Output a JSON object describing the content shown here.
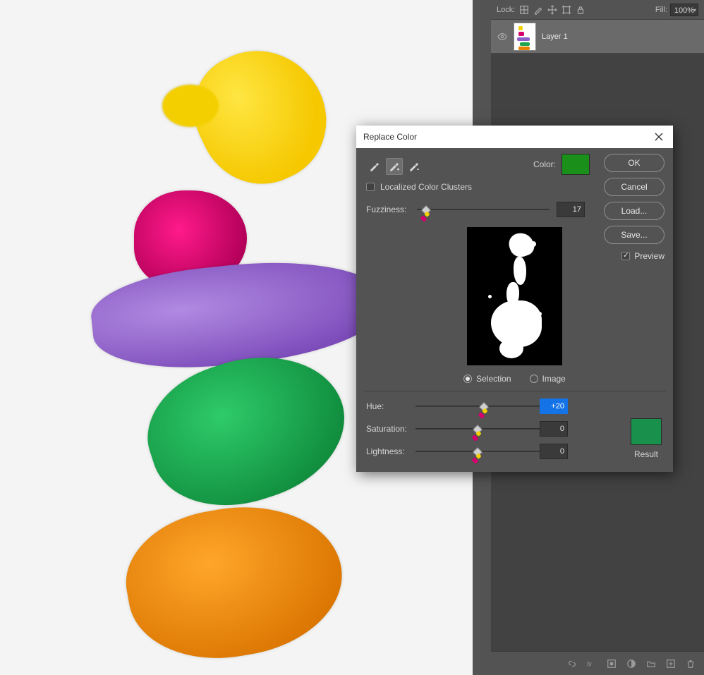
{
  "layers_panel": {
    "lock_label": "Lock:",
    "fill_label": "Fill:",
    "fill_value": "100%",
    "layer_name": "Layer 1"
  },
  "dialog": {
    "title": "Replace Color",
    "color_label": "Color:",
    "color_swatch": "#1a8f1a",
    "localized_label": "Localized Color Clusters",
    "localized_checked": false,
    "fuzziness_label": "Fuzziness:",
    "fuzziness_value": "17",
    "fuzziness_pos_pct": 7,
    "radio_selection": "Selection",
    "radio_image": "Image",
    "radio_state": "selection",
    "hue_label": "Hue:",
    "hue_value": "+20",
    "hue_pos_pct": 55,
    "sat_label": "Saturation:",
    "sat_value": "0",
    "sat_pos_pct": 50,
    "light_label": "Lightness:",
    "light_value": "0",
    "light_pos_pct": 50,
    "result_label": "Result",
    "result_swatch": "#19914c",
    "buttons": {
      "ok": "OK",
      "cancel": "Cancel",
      "load": "Load...",
      "save": "Save..."
    },
    "preview_label": "Preview",
    "preview_checked": true
  },
  "artwork_colors": {
    "yellow": "#f5d100",
    "pink": "#d6006c",
    "purple": "#8c5fc8",
    "green": "#1ea34e",
    "orange": "#e78200"
  }
}
